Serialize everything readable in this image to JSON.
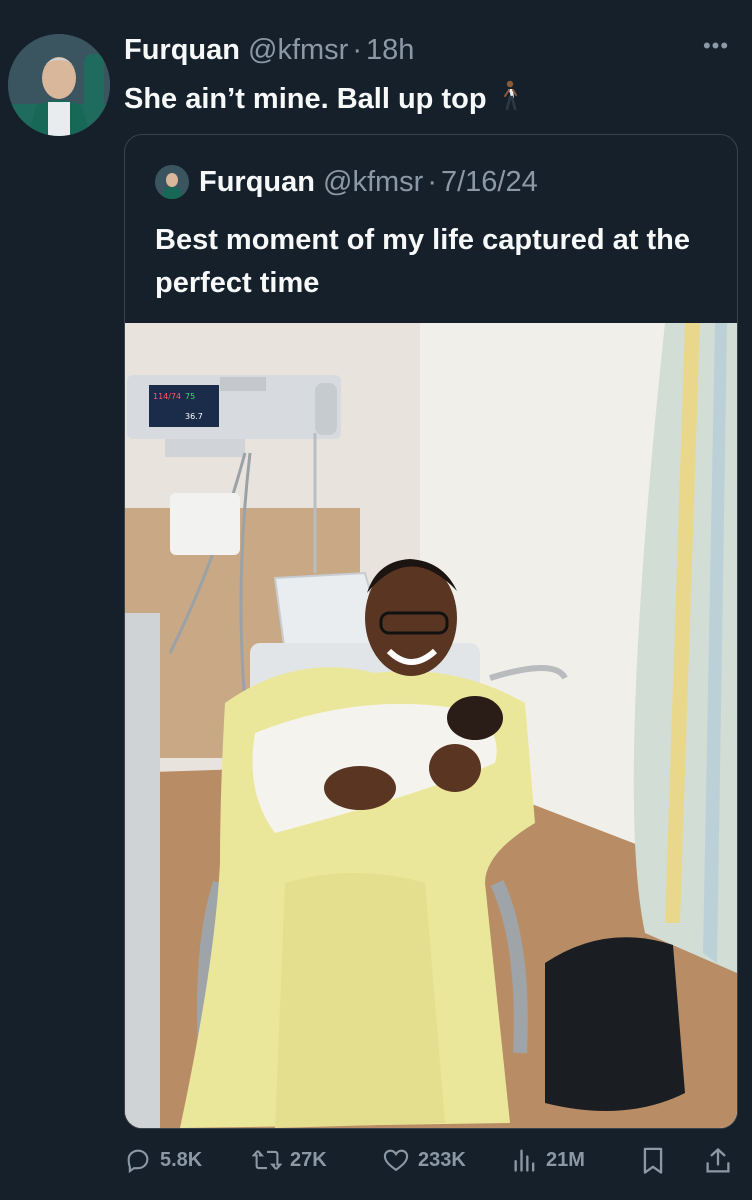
{
  "tweet": {
    "author_name": "Furquan",
    "handle": "@kfmsr",
    "separator": "·",
    "time": "18h",
    "text": "She ain’t mine. Ball up top",
    "emoji": "🚶🏾",
    "more_label": "•••"
  },
  "quoted": {
    "author_name": "Furquan",
    "handle": "@kfmsr",
    "separator": "·",
    "date": "7/16/24",
    "text": "Best moment of my life captured at the perfect time",
    "monitor_readout_1": "114/74",
    "monitor_readout_2": "75",
    "monitor_readout_3": "36.7"
  },
  "actions": {
    "replies": "5.8K",
    "reposts": "27K",
    "likes": "233K",
    "views": "21M"
  },
  "colors": {
    "background": "#15202b",
    "text_primary": "#f7f9f9",
    "text_secondary": "#8b98a5",
    "border": "#38444d"
  },
  "icons": [
    "more-icon",
    "reply-icon",
    "repost-icon",
    "like-icon",
    "views-icon",
    "bookmark-icon",
    "share-icon"
  ]
}
